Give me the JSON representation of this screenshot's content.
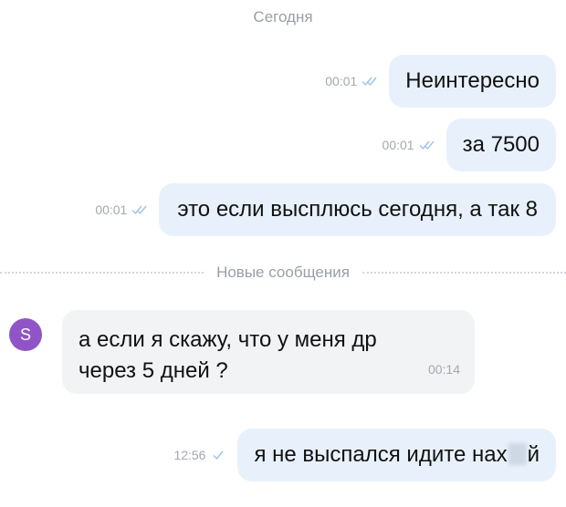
{
  "date_header": "Сегодня",
  "outgoing": [
    {
      "text": "Неинтересно",
      "time": "00:01",
      "status": "read-double-check-icon"
    },
    {
      "text": "за 7500",
      "time": "00:01",
      "status": "read-double-check-icon"
    },
    {
      "text": "это если высплюсь сегодня, а так 8",
      "time": "00:01",
      "status": "read-double-check-icon"
    }
  ],
  "separator": "Новые сообщения",
  "incoming": {
    "avatar_letter": "S",
    "avatar_color": "#8f55c6",
    "line1": "а если я скажу, что у меня др",
    "line2": "через 5 дней ?",
    "time": "00:14"
  },
  "last_outgoing": {
    "text_before": "я не выспался идите нах",
    "text_after": "й",
    "time": "12:56",
    "status": "sent-single-check-icon"
  },
  "colors": {
    "outgoing_bubble": "#e8f1fb",
    "incoming_bubble": "#f2f3f5",
    "check": "#9cc3ea",
    "meta_text": "#a4a8ad"
  }
}
